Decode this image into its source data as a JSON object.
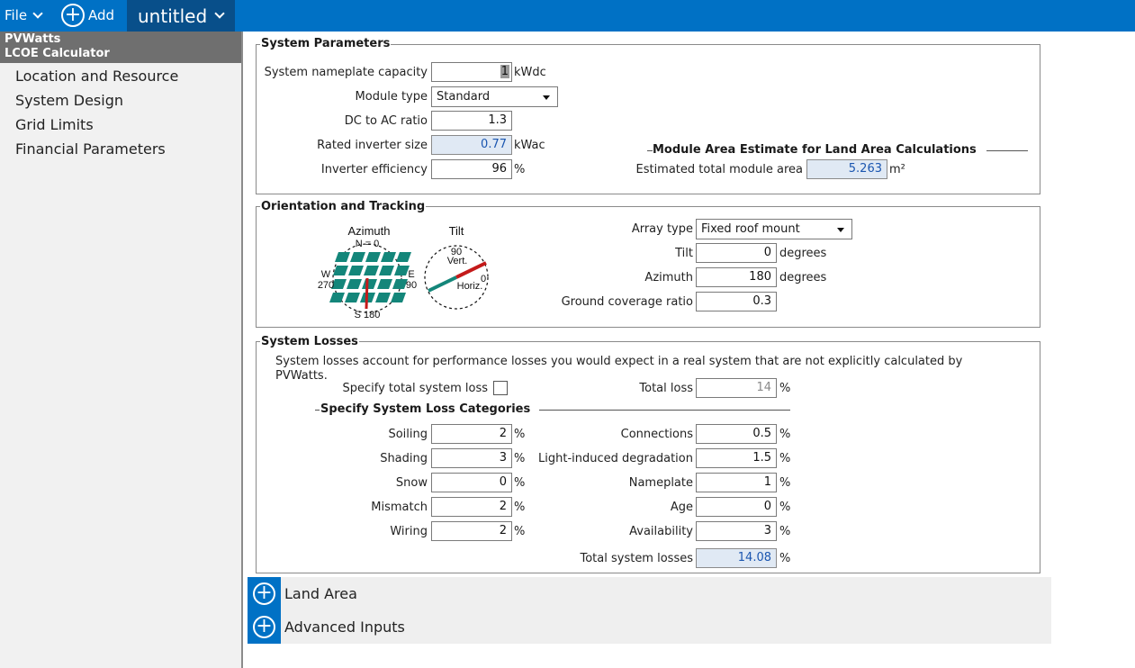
{
  "topbar": {
    "file": "File",
    "add": "Add",
    "document": "untitled"
  },
  "sidebar": {
    "title_line1": "PVWatts",
    "title_line2": "LCOE Calculator",
    "items": [
      {
        "label": "Location and Resource"
      },
      {
        "label": "System Design"
      },
      {
        "label": "Grid Limits"
      },
      {
        "label": "Financial Parameters"
      }
    ]
  },
  "system_parameters": {
    "title": "System Parameters",
    "nameplate_label": "System nameplate capacity",
    "nameplate_value": "1",
    "nameplate_unit": "kWdc",
    "module_type_label": "Module type",
    "module_type_value": "Standard",
    "dc_ac_label": "DC to AC ratio",
    "dc_ac_value": "1.3",
    "inverter_size_label": "Rated inverter size",
    "inverter_size_value": "0.77",
    "inverter_size_unit": "kWac",
    "inverter_eff_label": "Inverter efficiency",
    "inverter_eff_value": "96",
    "inverter_eff_unit": "%",
    "module_area_title": "Module Area Estimate for Land Area Calculations",
    "module_area_label": "Estimated total module area",
    "module_area_value": "5.263",
    "module_area_unit": "m²"
  },
  "orientation": {
    "title": "Orientation and Tracking",
    "diagram": {
      "azimuth_title": "Azimuth",
      "tilt_title": "Tilt",
      "north": "N = 0",
      "west_label": "W",
      "west_value": "270",
      "east_label": "E",
      "east_value": "90",
      "south": "S 180",
      "tilt_vert_value": "90",
      "tilt_vert_label": "Vert.",
      "tilt_horiz_value": "0",
      "tilt_horiz_label": "Horiz."
    },
    "array_type_label": "Array type",
    "array_type_value": "Fixed roof mount",
    "tilt_label": "Tilt",
    "tilt_value": "0",
    "tilt_unit": "degrees",
    "azimuth_label": "Azimuth",
    "azimuth_value": "180",
    "azimuth_unit": "degrees",
    "gcr_label": "Ground coverage ratio",
    "gcr_value": "0.3"
  },
  "losses": {
    "title": "System Losses",
    "description": "System losses account for performance losses you would expect in a real system that are not explicitly calculated by PVWatts.",
    "specify_total_label": "Specify total system loss",
    "specify_total_checked": false,
    "total_loss_label": "Total loss",
    "total_loss_value": "14",
    "total_loss_unit": "%",
    "categories_title": "Specify System Loss Categories",
    "left": [
      {
        "label": "Soiling",
        "value": "2",
        "unit": "%"
      },
      {
        "label": "Shading",
        "value": "3",
        "unit": "%"
      },
      {
        "label": "Snow",
        "value": "0",
        "unit": "%"
      },
      {
        "label": "Mismatch",
        "value": "2",
        "unit": "%"
      },
      {
        "label": "Wiring",
        "value": "2",
        "unit": "%"
      }
    ],
    "right": [
      {
        "label": "Connections",
        "value": "0.5",
        "unit": "%"
      },
      {
        "label": "Light-induced degradation",
        "value": "1.5",
        "unit": "%"
      },
      {
        "label": "Nameplate",
        "value": "1",
        "unit": "%"
      },
      {
        "label": "Age",
        "value": "0",
        "unit": "%"
      },
      {
        "label": "Availability",
        "value": "3",
        "unit": "%"
      }
    ],
    "total_system_label": "Total system losses",
    "total_system_value": "14.08",
    "total_system_unit": "%"
  },
  "sections": [
    {
      "label": "Land Area"
    },
    {
      "label": "Advanced Inputs"
    }
  ],
  "colors": {
    "accent": "#0071c5",
    "tab_dark": "#084f8a",
    "calc_field": "#e0e9f4",
    "panel_teal": "#14867a",
    "needle_red": "#c41a1a"
  }
}
